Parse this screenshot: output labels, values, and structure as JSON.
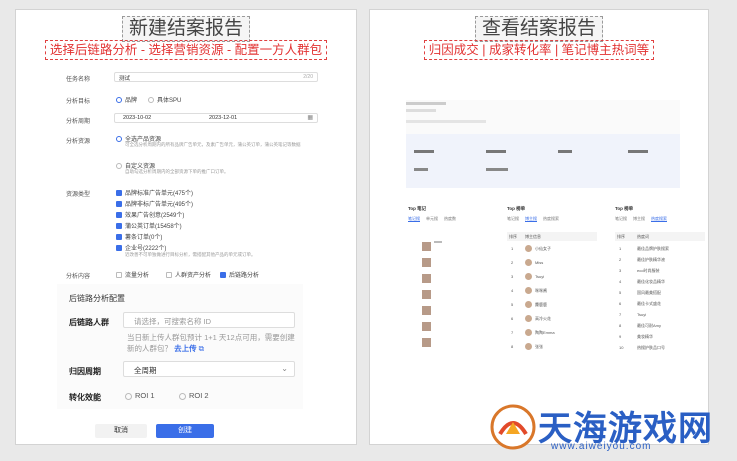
{
  "left": {
    "title": "新建结案报告",
    "subtitle": "选择后链路分析 - 选择营销资源 - 配置一方人群包",
    "task_name_label": "任务名称",
    "task_name_value": "测试",
    "task_name_count": "2/20",
    "target_label": "分析目标",
    "target_opt1": "品牌",
    "target_opt2": "具体SPU",
    "period_label": "分析周期",
    "start_date": "2023-10-02",
    "end_date": "2023-12-01",
    "resource_label": "分析资源",
    "res_opt1": "全选产品资源",
    "res_opt1_desc": "可全选分析周期内的所有品牌广告单元，及素广告单元，蒲公英订单，蒲公英笔记等数据",
    "res_opt2": "自定义资源",
    "res_opt2_desc": "自助勾选分析周期内的全部资源下单的推广口订单。",
    "type_label": "资源类型",
    "types": [
      "品牌标准广告单元(475个)",
      "品牌非标广告单元(495个)",
      "效果广告创意(2549个)",
      "蒲公英订单(15458个)",
      "薯条订单(0个)",
      "企业号(2222个)"
    ],
    "type_note": "近改善不可单独做进行目标分析，需搭配其他产品的单元或订单。",
    "content_label": "分析内容",
    "c1": "流量分析",
    "c2": "人群资产分析",
    "c3": "后链路分析",
    "config_title": "后链路分析配置",
    "crowd_label": "后链路人群",
    "crowd_placeholder": "请选择，可搜索名称 ID",
    "crowd_hint": "当日新上传人群包预计 1+1 天12点可用，需要创建新的人群包？",
    "upload": "去上传",
    "attr_label": "归因周期",
    "attr_value": "全周期",
    "eff_label": "转化效能",
    "roi1": "ROI 1",
    "roi2": "ROI 2",
    "cancel": "取消",
    "create": "创建"
  },
  "right": {
    "title": "查看结案报告",
    "subtitle": "归因成交 | 成家转化率 | 笔记博主热词等",
    "top1": "Top 笔记",
    "top2": "Top 榜单",
    "top3": "Top 榜单",
    "tabs1": [
      "笔记搜",
      "单元搜",
      "热度数"
    ],
    "tabs2": [
      "笔记搜",
      "博主搜",
      "热度搜索"
    ],
    "tabs3": [
      "笔记搜",
      "博主搜",
      "热度搜索"
    ],
    "col_rank": "排序",
    "col_name": "博主信息",
    "col_word": "热度词",
    "bloggers": [
      "小仙女子",
      "Miss",
      "Tsuyi",
      "咪咪酱",
      "麋鹿鹿",
      "高冷火花",
      "陶陶Emma",
      "张张"
    ],
    "words": [
      "最佳品牌护肤搜索",
      "最佳护肤精华液",
      "eco时尚服装",
      "最佳化妆品精华",
      "国风最美搭配",
      "最佳卡式盛花",
      "Tsuyi",
      "最佳可耐Amy",
      "美妆精华",
      "热搜护肤品口号"
    ]
  },
  "watermark": {
    "text": "天海游戏网",
    "url": "www.aiweiyou.com"
  }
}
